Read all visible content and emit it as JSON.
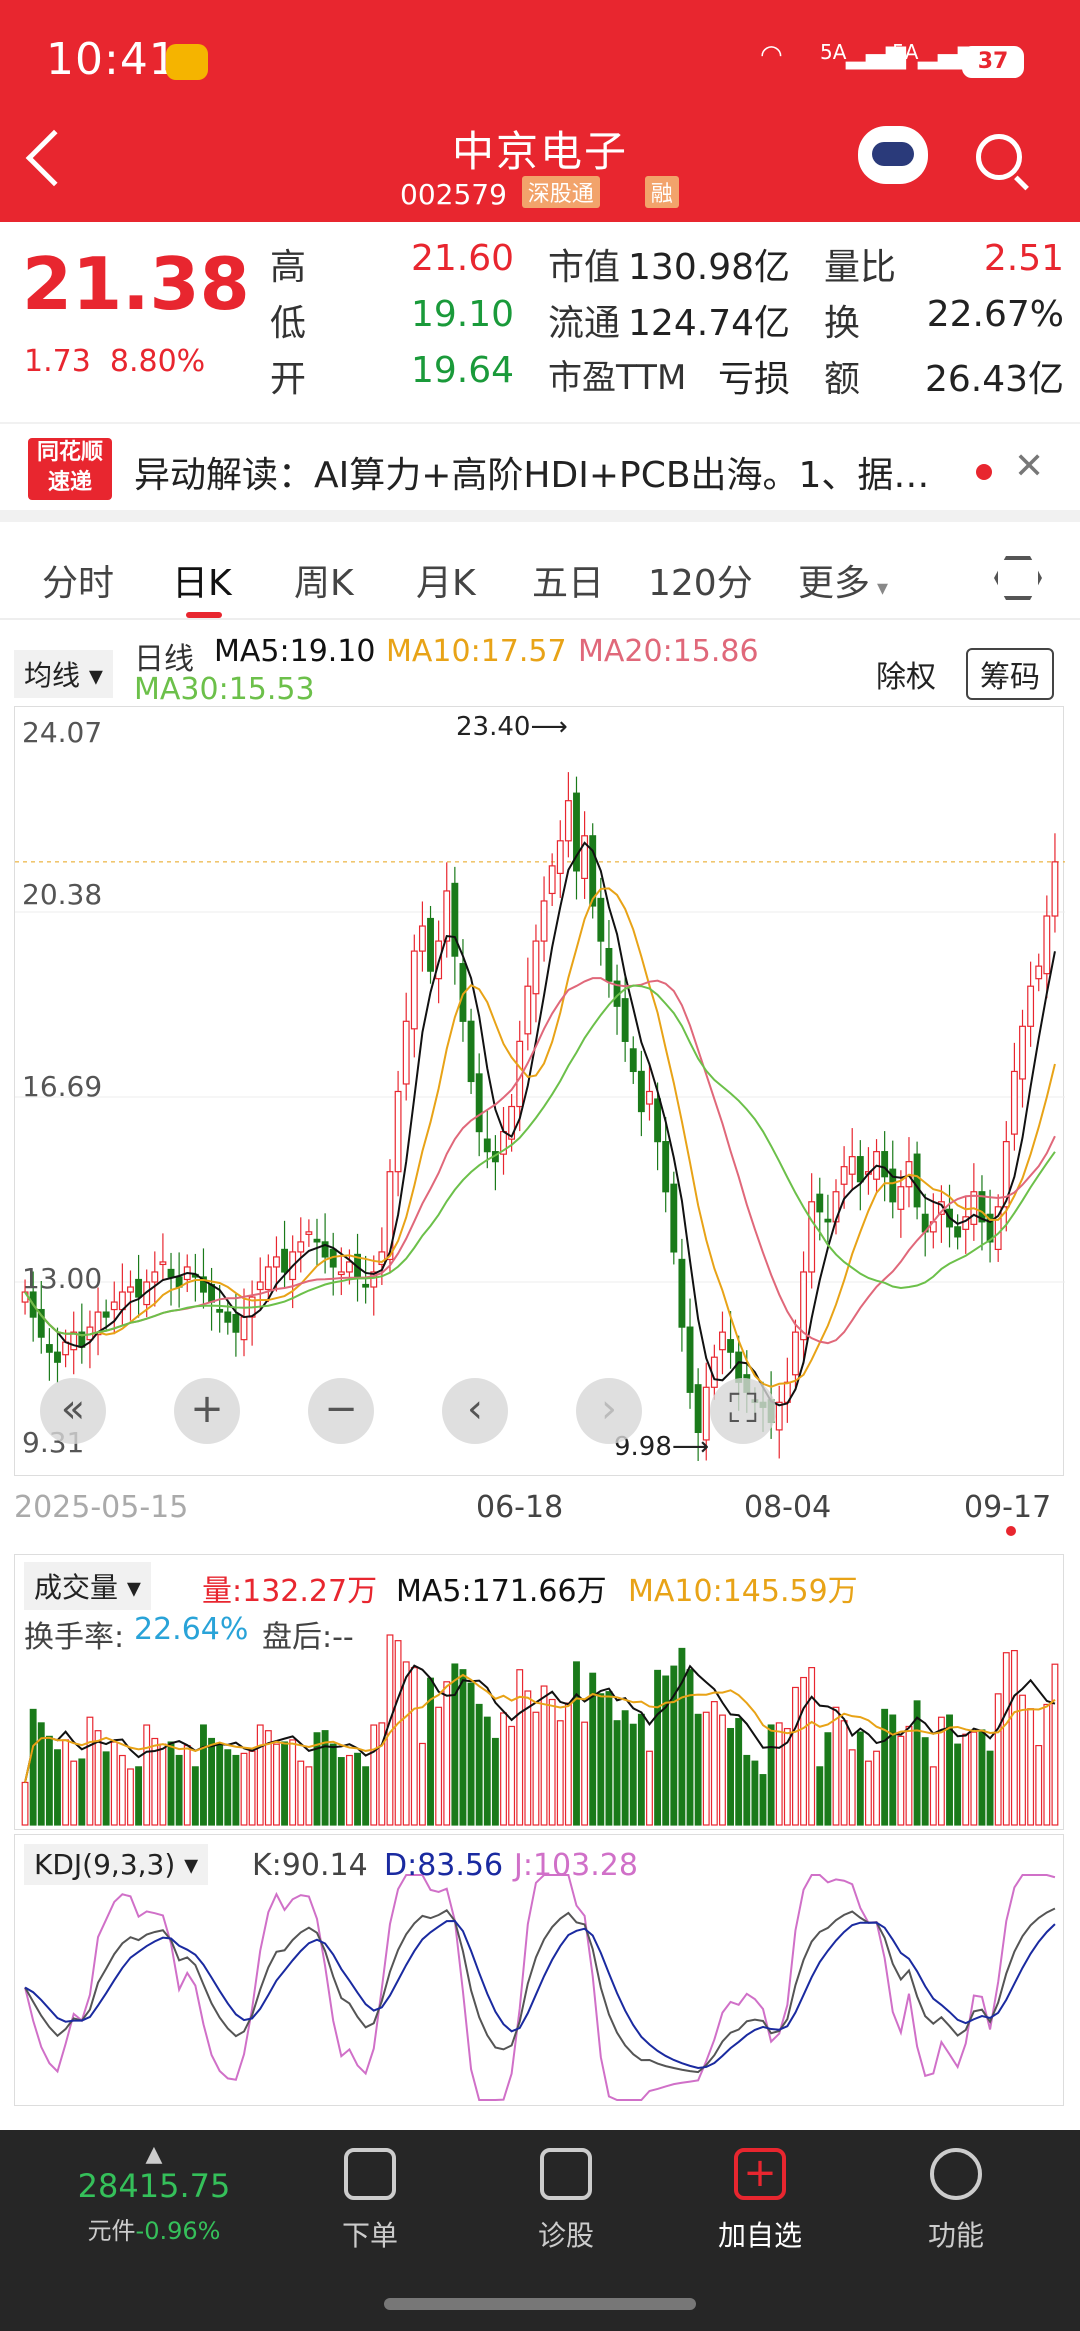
{
  "status": {
    "time": "10:41",
    "net1": "5A",
    "net2": "5A",
    "battery": "37"
  },
  "stock": {
    "name": "中京电子",
    "code": "002579",
    "tag1": "深股通",
    "tag2": "融"
  },
  "quote": {
    "price": "21.38",
    "change": "1.73",
    "change_pct": "8.80%",
    "high_label": "高",
    "high": "21.60",
    "low_label": "低",
    "low": "19.10",
    "open_label": "开",
    "open": "19.64",
    "mcap_label": "市值",
    "mcap": "130.98亿",
    "float_label": "流通",
    "float": "124.74亿",
    "pe_label": "市盈TTM",
    "pe": "亏损",
    "vr_label": "量比",
    "vr": "2.51",
    "turn_label": "换",
    "turn": "22.67%",
    "amt_label": "额",
    "amt": "26.43亿"
  },
  "news": {
    "logo1": "同花顺",
    "logo2": "速递",
    "text": "异动解读：AI算力+高阶HDI+PCB出海。1、据…"
  },
  "tabs": [
    "分时",
    "日K",
    "周K",
    "月K",
    "五日",
    "120分",
    "更多"
  ],
  "ma": {
    "pill": "均线",
    "line": "日线",
    "ma5": "MA5:19.10",
    "ma10": "MA10:17.57",
    "ma20": "MA20:15.86",
    "ma30": "MA30:15.53",
    "rights": "除权",
    "chips": "筹码"
  },
  "yaxis": [
    "24.07",
    "20.38",
    "16.69",
    "13.00",
    "9.31"
  ],
  "annot": {
    "max": "23.40",
    "min": "9.98"
  },
  "xaxis": [
    "2025-05-15",
    "06-18",
    "08-04",
    "09-17"
  ],
  "volume": {
    "pill": "成交量",
    "vol": "量:132.27万",
    "ma5": "MA5:171.66万",
    "ma10": "MA10:145.59万",
    "turn_label": "换手率:",
    "turn": "22.64%",
    "after": "盘后:--"
  },
  "kdj": {
    "pill": "KDJ(9,3,3)",
    "k": "K:90.14",
    "d": "D:83.56",
    "j": "J:103.28"
  },
  "nav": {
    "index_val": "28415.75",
    "index_label": "元件",
    "index_chg": "-0.96%",
    "items": [
      "下单",
      "诊股",
      "加自选",
      "功能"
    ]
  },
  "colors": {
    "up": "#e8262f",
    "down": "#1a7a1a",
    "ma5": "#111111",
    "ma10": "#e8a317",
    "ma20": "#e0687a",
    "ma30": "#6cc04a"
  },
  "chart_data": {
    "type": "candlestick",
    "title": "中京电子 日K",
    "ylim": [
      9.31,
      24.07
    ],
    "close": [
      12.8,
      12.3,
      11.9,
      11.6,
      11.4,
      11.8,
      12.0,
      11.7,
      12.1,
      12.4,
      12.3,
      12.6,
      12.8,
      12.9,
      12.7,
      13.0,
      13.2,
      13.4,
      13.1,
      12.9,
      13.3,
      13.1,
      12.8,
      12.6,
      12.4,
      12.2,
      12.0,
      12.3,
      12.7,
      13.0,
      13.3,
      13.5,
      13.2,
      13.6,
      13.8,
      14.0,
      13.8,
      13.5,
      13.3,
      13.2,
      13.4,
      13.1,
      12.9,
      13.2,
      13.6,
      15.2,
      16.8,
      18.2,
      19.6,
      20.1,
      19.2,
      19.8,
      20.8,
      19.5,
      18.2,
      17.0,
      16.0,
      15.6,
      15.4,
      16.0,
      16.5,
      17.8,
      18.9,
      19.8,
      20.6,
      21.3,
      21.8,
      22.6,
      21.2,
      21.9,
      20.5,
      19.8,
      19.0,
      18.5,
      17.8,
      17.2,
      16.4,
      16.8,
      15.8,
      14.8,
      13.6,
      12.1,
      10.8,
      10.0,
      10.9,
      11.5,
      12.0,
      11.6,
      11.0,
      10.8,
      10.6,
      10.5,
      10.2,
      10.6,
      11.0,
      12.0,
      13.2,
      14.6,
      14.4,
      14.2,
      14.8,
      15.3,
      15.5,
      15.0,
      15.2,
      15.6,
      15.1,
      14.6,
      14.9,
      15.4,
      14.5,
      14.0,
      14.2,
      14.6,
      14.1,
      13.9,
      14.3,
      14.8,
      14.2,
      13.8,
      14.5,
      15.8,
      17.2,
      18.1,
      18.9,
      19.3,
      20.3,
      21.38
    ]
  }
}
